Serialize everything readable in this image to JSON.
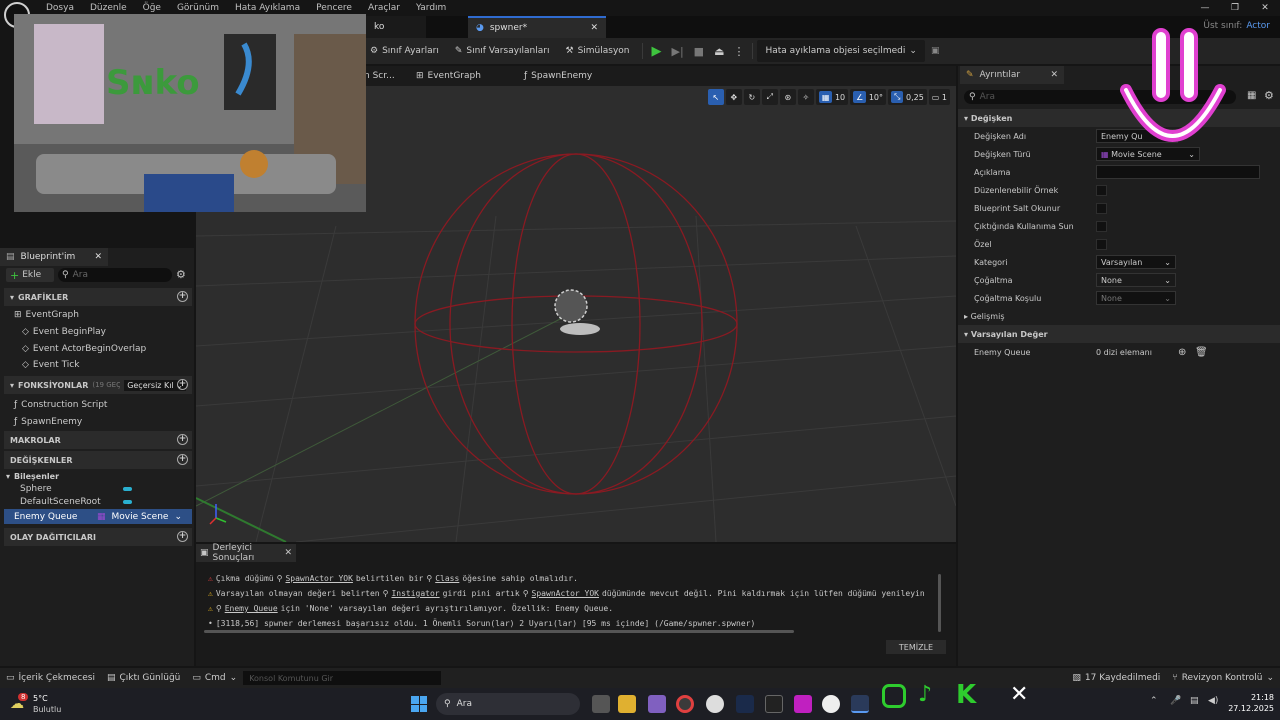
{
  "menu": [
    "Dosya",
    "Düzenle",
    "Öğe",
    "Görünüm",
    "Hata Ayıklama",
    "Pencere",
    "Araçlar",
    "Yardım"
  ],
  "parent_class": {
    "label": "Üst sınıf:",
    "value": "Actor"
  },
  "tabs": {
    "partial": "ko",
    "active": "spwner*"
  },
  "toolbar": {
    "class_settings": "Sınıf Ayarları",
    "class_defaults": "Sınıf Varsayılanları",
    "simulation": "Simülasyon",
    "debug_select": "Hata ayıklama objesi seçilmedi"
  },
  "graph_tabs": {
    "partial": "n Scr...",
    "event_graph": "EventGraph",
    "spawn_enemy": "SpawnEnemy"
  },
  "viewport": {
    "grid_snap": "10",
    "rot_snap": "10°",
    "scale_snap": "0,25",
    "cam_speed": "1"
  },
  "blueprint_panel": {
    "tab": "Blueprint'im",
    "add": "Ekle",
    "search_placeholder": "Ara",
    "graphs_hdr": "GRAFİKLER",
    "graph_name": "EventGraph",
    "events": [
      "Event BeginPlay",
      "Event ActorBeginOverlap",
      "Event Tick"
    ],
    "functions_hdr": "FONKSİYONLAR",
    "functions_count": "(19 GEÇERSİ",
    "override": "Geçersiz Kıl",
    "functions": [
      "Construction Script",
      "SpawnEnemy"
    ],
    "macros_hdr": "MAKROLAR",
    "variables_hdr": "DEĞİŞKENLER",
    "components_hdr": "Bileşenler",
    "components": [
      "Sphere",
      "DefaultSceneRoot"
    ],
    "selected_var": "Enemy Queue",
    "selected_var_type": "Movie Scene",
    "dispatchers_hdr": "OLAY DAĞITICILARI"
  },
  "details": {
    "tab": "Ayrıntılar",
    "search_placeholder": "Ara",
    "variable_hdr": "Değişken",
    "var_name_label": "Değişken Adı",
    "var_name": "Enemy Qu",
    "var_type_label": "Değişken Türü",
    "var_type": "Movie Scene",
    "description_label": "Açıklama",
    "editable_label": "Düzenlenebilir Örnek",
    "readonly_label": "Blueprint Salt Okunur",
    "expose_label": "Çıktığında Kullanıma Sun",
    "private_label": "Özel",
    "category_label": "Kategori",
    "category": "Varsayılan",
    "replication_label": "Çoğaltma",
    "replication": "None",
    "rep_condition_label": "Çoğaltma Koşulu",
    "rep_condition": "None",
    "advanced": "Gelişmiş",
    "default_hdr": "Varsayılan Değer",
    "default_name": "Enemy Queue",
    "default_value": "0 dizi elemanı"
  },
  "compiler": {
    "tab": "Derleyici Sonuçları",
    "line1": {
      "a": "Çıkma düğümü",
      "b": "SpawnActor YOK",
      "c": "belirtilen bir",
      "d": "Class",
      "e": "öğesine sahip olmalıdır."
    },
    "line2": {
      "a": "Varsayılan olmayan değeri belirten",
      "b": "Instigator",
      "c": "girdi pini artık",
      "d": "SpawnActor YOK",
      "e": "düğümünde mevcut değil. Pini kaldırmak için lütfen düğümü yenileyin"
    },
    "line3": {
      "a": "Enemy Queue",
      "b": "için 'None' varsayılan değeri ayrıştırılamıyor. Özellik: Enemy Queue."
    },
    "line4": "[3118,56] spwner derlemesi başarısız oldu. 1 Önemli Sorun(lar) 2 Uyarı(lar) [95 ms içinde] (/Game/spwner.spwner)",
    "clear": "TEMİZLE"
  },
  "statusbar": {
    "content_drawer": "İçerik Çekmecesi",
    "output_log": "Çıktı Günlüğü",
    "cmd": "Cmd",
    "console_placeholder": "Konsol Komutunu Gir",
    "saved": "17 Kaydedilmedi",
    "revision": "Revizyon Kontrolü"
  },
  "taskbar": {
    "temp": "5°C",
    "weather": "Bulutlu",
    "badge": "8",
    "search": "Ara",
    "time": "21:18",
    "date": "27.12.2025"
  },
  "colors": {
    "accent": "#2f6bd0",
    "sphere": "#8a1a22",
    "warn": "#e0b020",
    "error": "#e04040",
    "overlay_pink": "#e040d0"
  }
}
